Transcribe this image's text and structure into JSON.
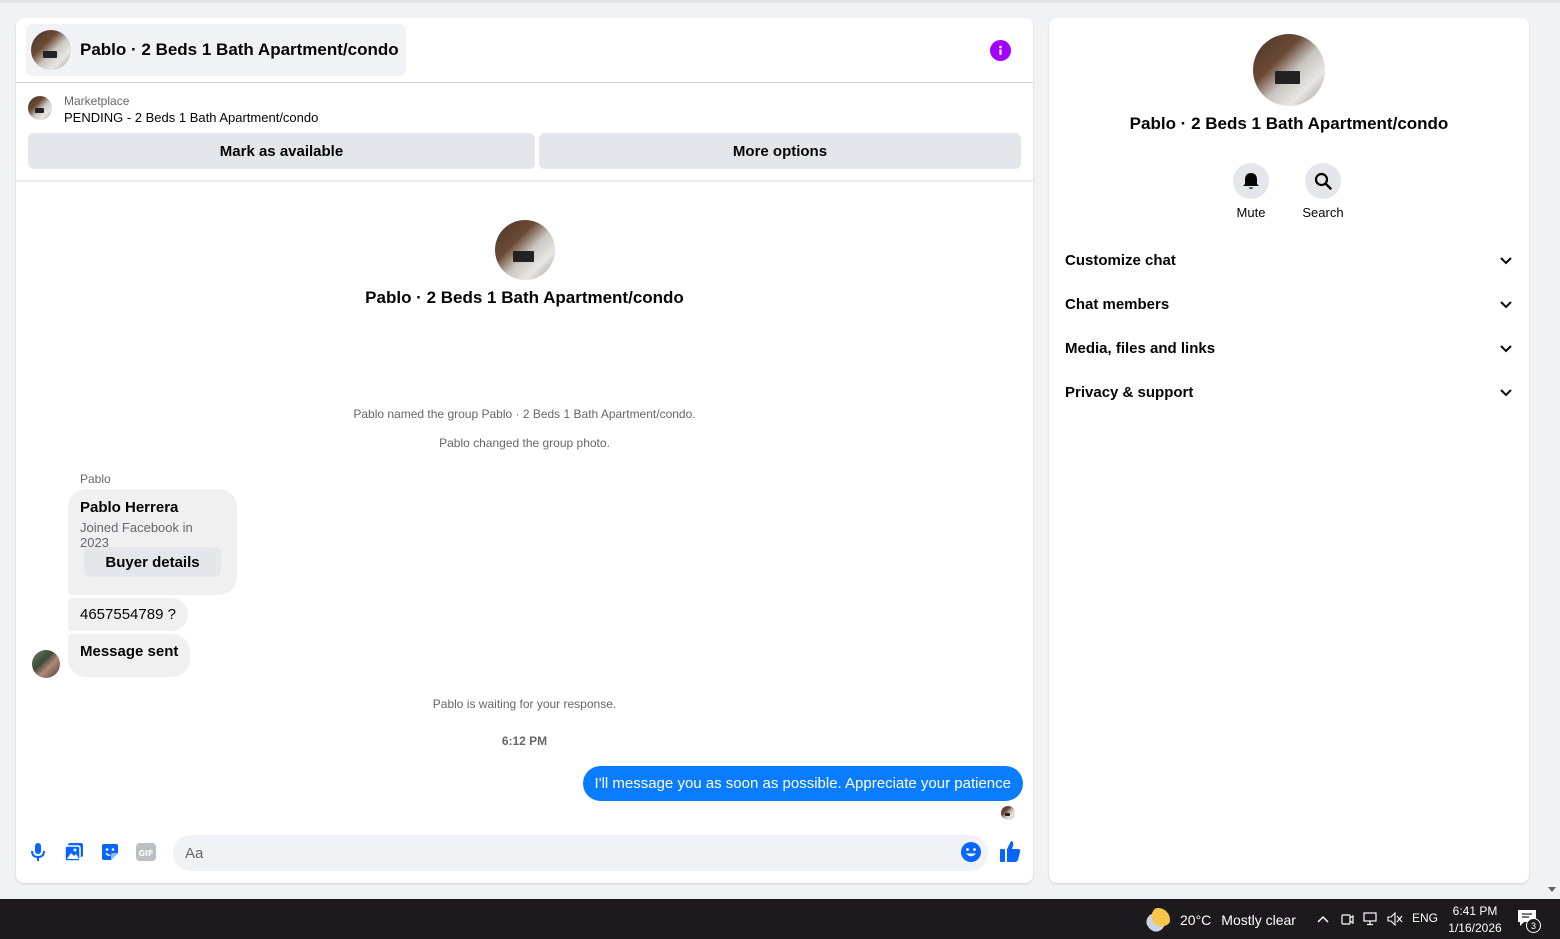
{
  "chat": {
    "title": "Pablo · 2 Beds 1 Bath Apartment/condo",
    "listing": {
      "source": "Marketplace",
      "status": "PENDING - 2 Beds 1 Bath Apartment/condo",
      "mark_available_label": "Mark as available",
      "more_options_label": "More options"
    },
    "center_title": "Pablo · 2 Beds 1 Bath Apartment/condo",
    "system_messages": [
      "Pablo named the group Pablo · 2 Beds 1 Bath Apartment/condo.",
      "Pablo changed the group photo.",
      "Pablo is waiting for your response."
    ],
    "sender_name": "Pablo",
    "profile_card": {
      "name": "Pablo Herrera",
      "joined": "Joined Facebook in 2023",
      "buyer_details_label": "Buyer details"
    },
    "incoming_messages": [
      "4657554789 ?",
      "Message sent"
    ],
    "timestamp": "6:12 PM",
    "outgoing_message": "I'll message you as soon as possible. Appreciate your patience",
    "composer": {
      "placeholder": "Aa"
    }
  },
  "info_panel": {
    "title": "Pablo · 2 Beds 1 Bath Apartment/condo",
    "actions": {
      "mute_label": "Mute",
      "search_label": "Search"
    },
    "sections": [
      "Customize chat",
      "Chat members",
      "Media, files and links",
      "Privacy & support"
    ]
  },
  "taskbar": {
    "temperature": "20°C",
    "weather": "Mostly clear",
    "language": "ENG",
    "time": "6:41 PM",
    "date": "1/16/2026",
    "notification_count": "3"
  },
  "colors": {
    "accent_blue": "#0a7cff",
    "info_purple": "#a100ff",
    "icon_blue": "#0866ff"
  },
  "icons": [
    "info-icon",
    "microphone-icon",
    "photo-icon",
    "sticker-icon",
    "gif-icon",
    "emoji-icon",
    "thumbs-up-icon",
    "bell-icon",
    "search-icon",
    "chevron-down-icon",
    "weather-icon",
    "notification-icon"
  ]
}
